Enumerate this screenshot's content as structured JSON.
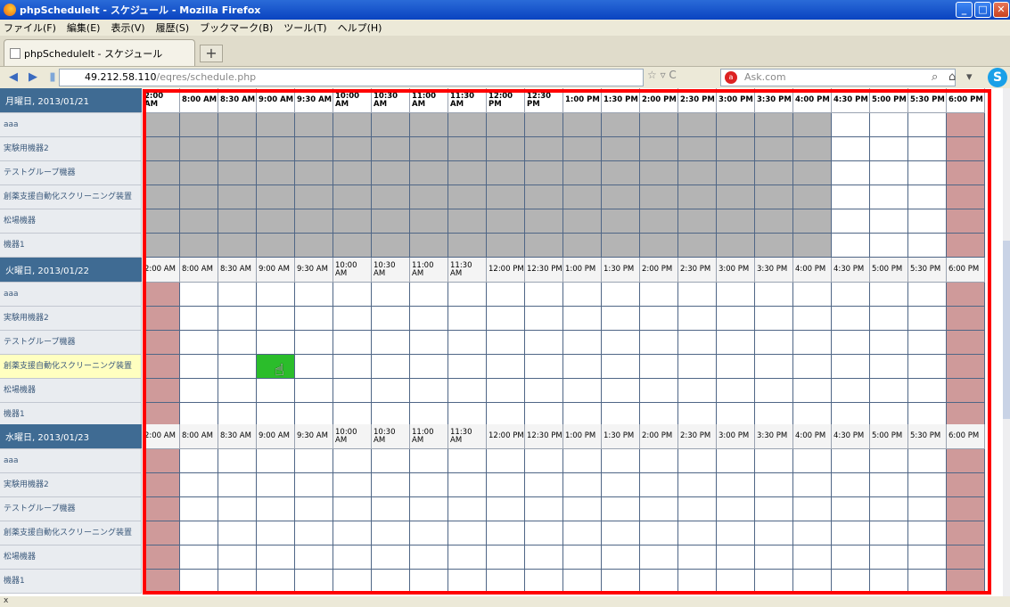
{
  "window": {
    "title": "phpScheduleIt - スケジュール - Mozilla Firefox"
  },
  "menu": [
    "ファイル(F)",
    "編集(E)",
    "表示(V)",
    "履歴(S)",
    "ブックマーク(B)",
    "ツール(T)",
    "ヘルプ(H)"
  ],
  "tab": {
    "title": "phpScheduleIt - スケジュール",
    "new_tab": "+"
  },
  "nav": {
    "url_host": "49.212.58.110",
    "url_path": "/eqres/schedule.php",
    "search_placeholder": "Ask.com"
  },
  "status": {
    "text": "x"
  },
  "schedule": {
    "time_labels": [
      "2:00 AM",
      "8:00 AM",
      "8:30 AM",
      "9:00 AM",
      "9:30 AM",
      "10:00 AM",
      "10:30 AM",
      "11:00 AM",
      "11:30 AM",
      "12:00 PM",
      "12:30 PM",
      "1:00 PM",
      "1:30 PM",
      "2:00 PM",
      "2:30 PM",
      "3:00 PM",
      "3:30 PM",
      "4:00 PM",
      "4:30 PM",
      "5:00 PM",
      "5:30 PM",
      "6:00 PM"
    ],
    "days": [
      {
        "label": "月曜日, 2013/01/21",
        "resources": [
          "aaa",
          "実験用機器2",
          "テストグループ機器",
          "創薬支援自動化スクリーニング装置",
          "松場機器",
          "機器1"
        ]
      },
      {
        "label": "火曜日, 2013/01/22",
        "resources": [
          "aaa",
          "実験用機器2",
          "テストグループ機器",
          "創薬支援自動化スクリーニング装置",
          "松場機器",
          "機器1"
        ]
      },
      {
        "label": "水曜日, 2013/01/23",
        "resources": [
          "aaa",
          "実験用機器2",
          "テストグループ機器",
          "創薬支援自動化スクリーニング装置",
          "松場機器",
          "機器1"
        ]
      }
    ],
    "colors": {
      "unavailable": "#b4b4b4",
      "blocked": "#cf9a9a",
      "selected": "#2bbd2b",
      "day_header": "#3f6b93",
      "frame": "#ff0000"
    }
  }
}
